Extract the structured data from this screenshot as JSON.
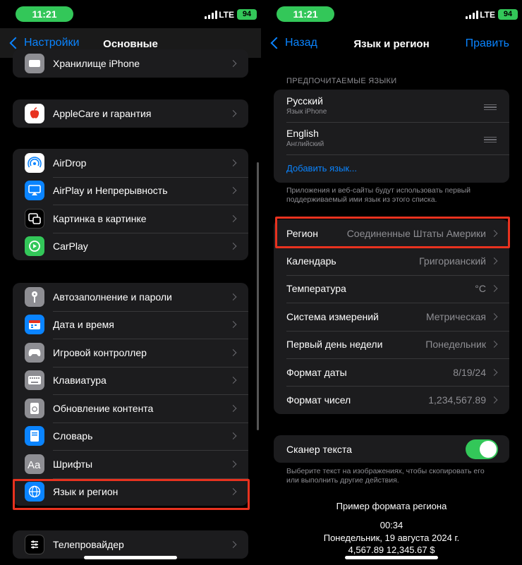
{
  "status": {
    "time": "11:21",
    "network": "LTE",
    "battery": "94"
  },
  "left": {
    "nav": {
      "back_label": "Настройки",
      "title": "Основные"
    },
    "group0": [
      {
        "label": "Хранилище iPhone",
        "icon": "storage-icon",
        "color": "#8e8e93"
      }
    ],
    "group1": [
      {
        "label": "AppleCare и гарантия",
        "icon": "apple-icon",
        "color": "#ffffff"
      }
    ],
    "group2": [
      {
        "label": "AirDrop",
        "icon": "airdrop-icon",
        "color": "#ffffff"
      },
      {
        "label": "AirPlay и Непрерывность",
        "icon": "airplay-icon",
        "color": "#0a84ff"
      },
      {
        "label": "Картинка в картинке",
        "icon": "pip-icon",
        "color": "#000000"
      },
      {
        "label": "CarPlay",
        "icon": "carplay-icon",
        "color": "#33c759"
      }
    ],
    "group3": [
      {
        "label": "Автозаполнение и пароли",
        "icon": "key-icon",
        "color": "#8e8e93"
      },
      {
        "label": "Дата и время",
        "icon": "calendar-icon",
        "color": "#0a84ff"
      },
      {
        "label": "Игровой контроллер",
        "icon": "gamepad-icon",
        "color": "#8e8e93"
      },
      {
        "label": "Клавиатура",
        "icon": "keyboard-icon",
        "color": "#8e8e93"
      },
      {
        "label": "Обновление контента",
        "icon": "refresh-icon",
        "color": "#8e8e93"
      },
      {
        "label": "Словарь",
        "icon": "book-icon",
        "color": "#0a84ff"
      },
      {
        "label": "Шрифты",
        "icon": "fonts-icon",
        "color": "#8e8e93"
      },
      {
        "label": "Язык и регион",
        "icon": "globe-icon",
        "color": "#0a84ff"
      }
    ],
    "group4": [
      {
        "label": "Телепровайдер",
        "icon": "tv-provider-icon",
        "color": "#000000"
      }
    ]
  },
  "right": {
    "nav": {
      "back_label": "Назад",
      "title": "Язык и регион",
      "edit_label": "Править"
    },
    "languages_header": "ПРЕДПОЧИТАЕМЫЕ ЯЗЫКИ",
    "languages": [
      {
        "name": "Русский",
        "sub": "Язык iPhone"
      },
      {
        "name": "English",
        "sub": "Английский"
      }
    ],
    "add_language": "Добавить язык...",
    "languages_footer": "Приложения и веб-сайты будут использовать первый поддерживаемый ими язык из этого списка.",
    "settings": [
      {
        "label": "Регион",
        "value": "Соединенные Штаты Америки"
      },
      {
        "label": "Календарь",
        "value": "Григорианский"
      },
      {
        "label": "Температура",
        "value": "°C"
      },
      {
        "label": "Система измерений",
        "value": "Метрическая"
      },
      {
        "label": "Первый день недели",
        "value": "Понедельник"
      },
      {
        "label": "Формат даты",
        "value": "8/19/24"
      },
      {
        "label": "Формат чисел",
        "value": "1,234,567.89"
      }
    ],
    "scanner_label": "Сканер текста",
    "scanner_on": true,
    "scanner_footer": "Выберите текст на изображениях, чтобы скопировать его или выполнить другие действия.",
    "example": {
      "title": "Пример формата региона",
      "time": "00:34",
      "date": "Понедельник, 19 августа 2024 г.",
      "numbers": "4,567.89 12,345.67 $"
    }
  },
  "colors": {
    "accent": "#0a84ff",
    "toggle_on": "#33c759",
    "highlight": "#e8321f"
  }
}
